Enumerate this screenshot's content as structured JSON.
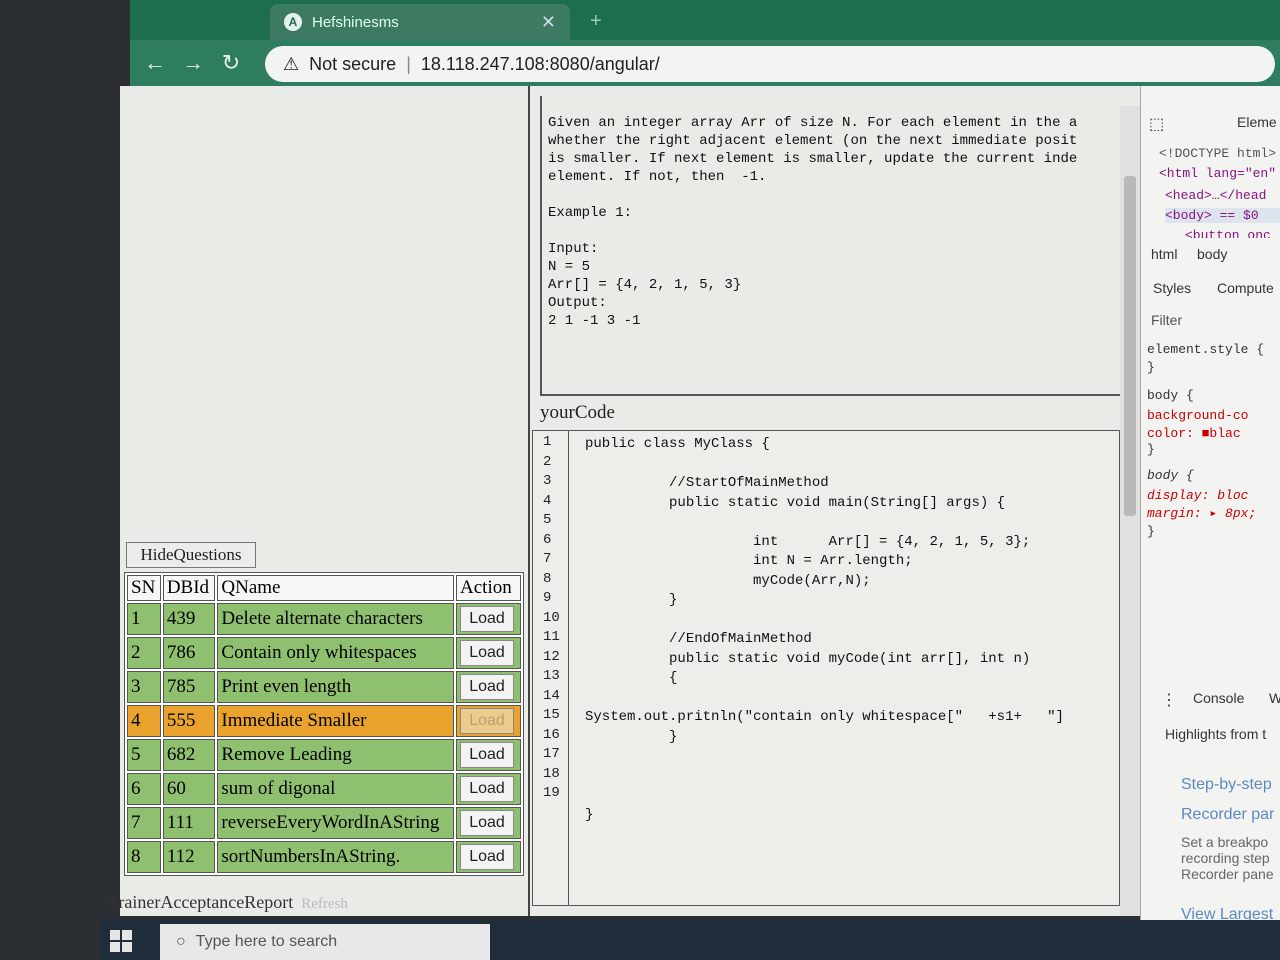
{
  "browser": {
    "tab_title": "Hefshinesms",
    "favicon_letter": "A",
    "security_label": "Not secure",
    "separator": "|",
    "url": "18.118.247.108:8080/angular/"
  },
  "left": {
    "hide_button": "HideQuestions",
    "table": {
      "headers": [
        "SN",
        "DBId",
        "QName",
        "Action"
      ],
      "rows": [
        {
          "sn": "1",
          "dbid": "439",
          "qname": "Delete alternate characters",
          "action": "Load"
        },
        {
          "sn": "2",
          "dbid": "786",
          "qname": "Contain only whitespaces",
          "action": "Load"
        },
        {
          "sn": "3",
          "dbid": "785",
          "qname": "Print even length",
          "action": "Load"
        },
        {
          "sn": "4",
          "dbid": "555",
          "qname": "Immediate Smaller",
          "action": "Load"
        },
        {
          "sn": "5",
          "dbid": "682",
          "qname": "Remove Leading",
          "action": "Load"
        },
        {
          "sn": "6",
          "dbid": "60",
          "qname": "sum of digonal",
          "action": "Load"
        },
        {
          "sn": "7",
          "dbid": "111",
          "qname": "reverseEveryWordInAString",
          "action": "Load"
        },
        {
          "sn": "8",
          "dbid": "112",
          "qname": "sortNumbersInAString.",
          "action": "Load"
        }
      ]
    },
    "trainer_label": "TrainerAcceptanceReport",
    "refresh_label": "Refresh"
  },
  "question": {
    "lines": [
      "Given an integer array Arr of size N. For each element in the a",
      "whether the right adjacent element (on the next immediate posit",
      "is smaller. If next element is smaller, update the current inde",
      "element. If not, then  -1."
    ],
    "example_label": "Example 1:",
    "example_lines": [
      "Input:",
      "N = 5",
      "Arr[] = {4, 2, 1, 5, 3}",
      "Output:",
      "2 1 -1 3 -1"
    ]
  },
  "editor": {
    "label": "yourCode",
    "line_numbers": [
      "1",
      "2",
      "3",
      "4",
      "5",
      "6",
      "7",
      "8",
      "9",
      "10",
      "11",
      "12",
      "13",
      "14",
      "15",
      "16",
      "17",
      "18",
      "19"
    ],
    "code_lines": [
      "public class MyClass {",
      "",
      "          //StartOfMainMethod",
      "          public static void main(String[] args) {",
      "",
      "                    int      Arr[] = {4, 2, 1, 5, 3};",
      "                    int N = Arr.length;",
      "                    myCode(Arr,N);",
      "          }",
      "",
      "          //EndOfMainMethod",
      "          public static void myCode(int arr[], int n)",
      "          {",
      "",
      "System.out.pritnln(\"contain only whitespace[\"   +s1+   \"]",
      "          }",
      "",
      "",
      "",
      "}"
    ]
  },
  "devtools": {
    "elements_tab": "Eleme",
    "doctype": "<!DOCTYPE html>",
    "html_tag": "<html lang=\"en\"",
    "head_tag": "<head>…</head",
    "body_tag": "<body> == $0",
    "button_tag": "<button onc",
    "breadcrumb": [
      "html",
      "body"
    ],
    "tabs": [
      "Styles",
      "Compute"
    ],
    "filter": "Filter",
    "rules": [
      "element.style {",
      "}",
      "body {",
      "  background-co",
      "  color: ■blac",
      "}",
      "body {",
      "  display: bloc",
      "  margin: ▸ 8px;",
      "}"
    ],
    "console_tab": "Console",
    "console_tab2": "W",
    "highlights": "Highlights from t",
    "recorder_title": "Step-by-step",
    "recorder_link": "Recorder par",
    "recorder_text": [
      "Set a breakpo",
      "recording step",
      "Recorder pane"
    ],
    "view_largest": "View Largest"
  },
  "taskbar": {
    "search_placeholder": "Type here to search"
  }
}
